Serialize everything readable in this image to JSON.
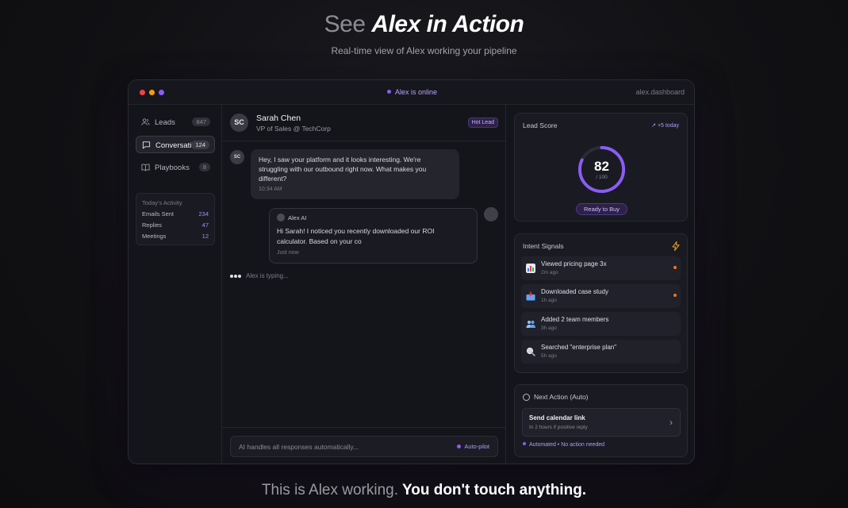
{
  "hero": {
    "title_muted": "See",
    "title_strong": "Alex in Action",
    "subtitle": "Real-time view of Alex working your pipeline"
  },
  "window": {
    "status": "Alex is online",
    "url": "alex.dashboard"
  },
  "sidebar": {
    "items": [
      {
        "label": "Leads",
        "count": "847",
        "icon": "users-icon"
      },
      {
        "label": "Conversations",
        "count": "124",
        "icon": "chat-icon"
      },
      {
        "label": "Playbooks",
        "count": "8",
        "icon": "book-icon"
      }
    ],
    "activity": {
      "heading": "Today's Activity",
      "rows": [
        {
          "label": "Emails Sent",
          "value": "234"
        },
        {
          "label": "Replies",
          "value": "47"
        },
        {
          "label": "Meetings",
          "value": "12"
        }
      ]
    }
  },
  "chat": {
    "contact": {
      "initials": "SC",
      "name": "Sarah Chen",
      "role": "VP of Sales @ TechCorp",
      "badge": "Hot Lead"
    },
    "incoming": {
      "initials": "SC",
      "text": "Hey, I saw your platform and it looks interesting. We're struggling with our outbound right now. What makes you different?",
      "time": "10:34 AM"
    },
    "outgoing": {
      "sender": "Alex AI",
      "text": "Hi Sarah! I noticed you recently downloaded our ROI calculator. Based on your co",
      "time": "Just now"
    },
    "typing": "Alex is typing...",
    "input_placeholder": "AI handles all responses automatically...",
    "autopilot": "Auto-pilot"
  },
  "lead_score": {
    "title": "Lead Score",
    "trend": "+5 today",
    "score": "82",
    "max": "/ 100",
    "score_fraction": 0.82,
    "status": "Ready to Buy"
  },
  "intent": {
    "title": "Intent Signals",
    "signals": [
      {
        "text": "Viewed pricing page 3x",
        "ago": "2m ago",
        "icon": "chart-icon",
        "hot": true
      },
      {
        "text": "Downloaded case study",
        "ago": "1h ago",
        "icon": "inbox-icon",
        "hot": true
      },
      {
        "text": "Added 2 team members",
        "ago": "3h ago",
        "icon": "team-icon",
        "hot": false
      },
      {
        "text": "Searched \"enterprise plan\"",
        "ago": "5h ago",
        "icon": "magnifier-icon",
        "hot": false
      }
    ]
  },
  "next_action": {
    "title": "Next Action (Auto)",
    "action": "Send calendar link",
    "detail": "In 2 hours if positive reply",
    "footer": "Automated • No action needed"
  },
  "tagline": {
    "muted": "This is Alex working.",
    "strong": "You don't touch anything."
  },
  "colors": {
    "accent": "#8b5cf6",
    "hot": "#f97316",
    "background": "#111114"
  }
}
